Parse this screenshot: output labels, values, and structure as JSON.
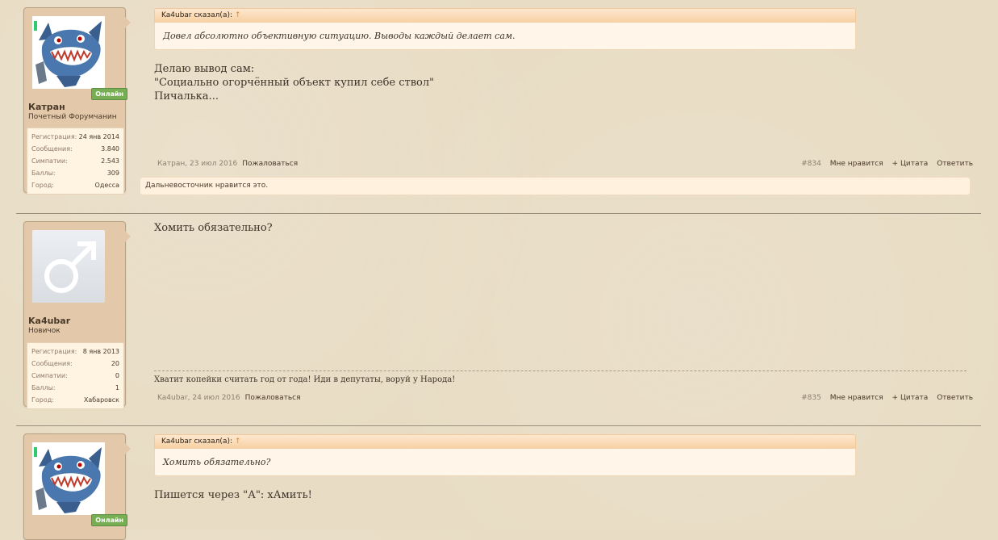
{
  "posts": [
    {
      "author": "Катран",
      "user_title": "Почетный Форумчанин",
      "online_label": "Онлайн",
      "stats": [
        {
          "key": "Регистрация:",
          "value": "24 янв 2014"
        },
        {
          "key": "Сообщения:",
          "value": "3.840"
        },
        {
          "key": "Симпатии:",
          "value": "2.543"
        },
        {
          "key": "Баллы:",
          "value": "309"
        },
        {
          "key": "Город:",
          "value": "Одесса"
        }
      ],
      "quote": {
        "header": "Ka4ubar сказал(а):",
        "arrow": "↑",
        "text": "Довел абсолютно объективную ситуацию. Выводы каждый делает сам."
      },
      "message_lines": [
        "Делаю вывод сам:",
        "\"Социально огорчённый объект купил себе ствол\"",
        "Пичалька..."
      ],
      "byline": "Катран, 23 июл 2016",
      "report": "Пожаловаться",
      "number": "#834",
      "like": "Мне нравится",
      "quote_action": "+ Цитата",
      "reply": "Ответить",
      "likes_text": "Дальневосточник нравится это."
    },
    {
      "author": "Ka4ubar",
      "user_title": "Новичок",
      "stats": [
        {
          "key": "Регистрация:",
          "value": "8 янв 2013"
        },
        {
          "key": "Сообщения:",
          "value": "20"
        },
        {
          "key": "Симпатии:",
          "value": "0"
        },
        {
          "key": "Баллы:",
          "value": "1"
        },
        {
          "key": "Город:",
          "value": "Хабаровск"
        }
      ],
      "message": "Хомить обязательно?",
      "signature": "Хватит копейки считать год от года! Иди в депутаты, воруй у Народа!",
      "byline": "Ka4ubar, 24 июл 2016",
      "report": "Пожаловаться",
      "number": "#835",
      "like": "Мне нравится",
      "quote_action": "+ Цитата",
      "reply": "Ответить"
    },
    {
      "online_label": "Онлайн",
      "quote": {
        "header": "Ka4ubar сказал(а):",
        "arrow": "↑",
        "text": "Хомить обязательно?"
      },
      "message": "Пишется через \"А\": хАмить!"
    }
  ],
  "colors": {
    "online": "#77ae54",
    "panel": "#e3c9a9",
    "quote_head": "#f7cfa2"
  }
}
